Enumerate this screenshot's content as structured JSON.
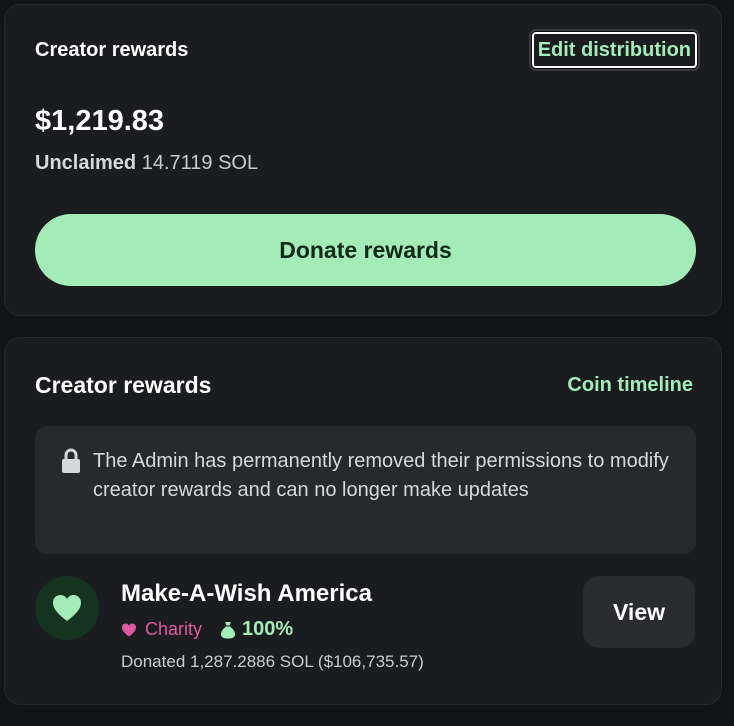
{
  "rewards_card": {
    "title": "Creator rewards",
    "edit_label": "Edit distribution",
    "amount": "$1,219.83",
    "unclaimed_label": "Unclaimed",
    "unclaimed_value": "14.7119 SOL",
    "donate_label": "Donate rewards"
  },
  "distribution_card": {
    "title": "Creator rewards",
    "timeline_label": "Coin timeline",
    "notice_icon": "lock-icon",
    "notice_text": "The Admin has permanently removed their permissions to modify creator rewards and can no longer make updates",
    "recipient": {
      "avatar_icon": "heart-icon",
      "name": "Make-A-Wish America",
      "tag_label": "Charity",
      "share_icon": "money-bag-icon",
      "share": "100%",
      "donated": "Donated 1,287.2886 SOL ($106,735.57)",
      "view_label": "View"
    }
  },
  "colors": {
    "accent_green": "#a3ecb7",
    "charity_pink": "#e05aa3",
    "card_bg": "#1b1c1f",
    "page_bg": "#121315"
  }
}
